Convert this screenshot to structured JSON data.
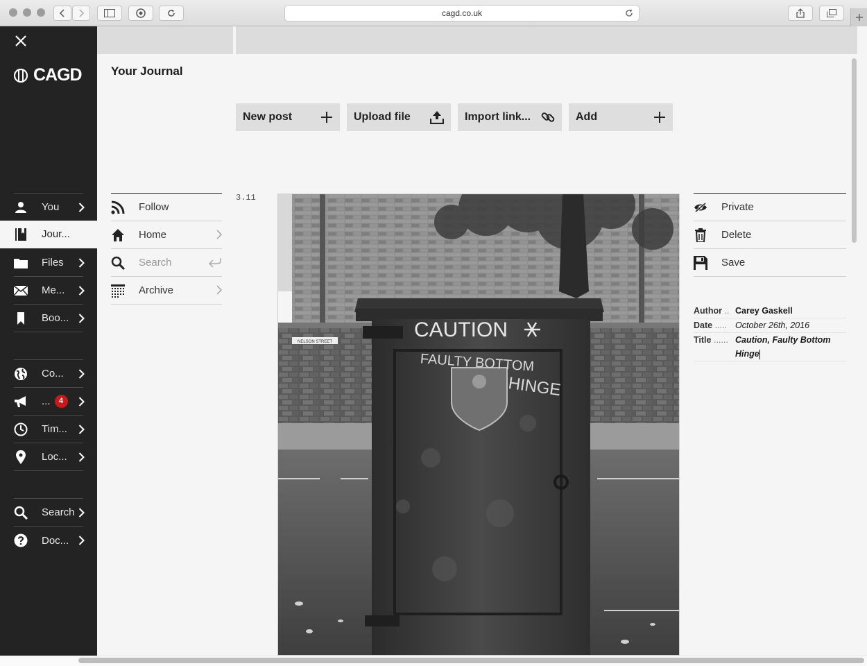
{
  "browser": {
    "url": "cagd.co.uk"
  },
  "sidebar": {
    "brand": "CAGD",
    "primary": [
      {
        "label": "You",
        "icon": "user-icon"
      },
      {
        "label": "Jour...",
        "icon": "journal-icon",
        "active": true
      },
      {
        "label": "Files",
        "icon": "folder-icon"
      },
      {
        "label": "Me...",
        "icon": "mail-icon"
      },
      {
        "label": "Boo...",
        "icon": "bookmark-icon"
      }
    ],
    "secondary": [
      {
        "label": "Co...",
        "icon": "globe-icon"
      },
      {
        "label": "...",
        "icon": "megaphone-icon",
        "badge": "4"
      },
      {
        "label": "Tim...",
        "icon": "clock-icon"
      },
      {
        "label": "Loc...",
        "icon": "pin-icon"
      }
    ],
    "tertiary": [
      {
        "label": "Search",
        "icon": "search-icon"
      },
      {
        "label": "Doc...",
        "icon": "help-icon"
      }
    ]
  },
  "page": {
    "title": "Your Journal"
  },
  "actions": [
    {
      "label": "New post",
      "icon": "plus-icon"
    },
    {
      "label": "Upload file",
      "icon": "upload-icon"
    },
    {
      "label": "Import link...",
      "icon": "link-icon"
    },
    {
      "label": "Add",
      "icon": "plus-icon"
    }
  ],
  "journal_nav": [
    {
      "label": "Follow",
      "icon": "rss-icon"
    },
    {
      "label": "Home",
      "icon": "home-icon"
    },
    {
      "label": "Search",
      "icon": "search-icon",
      "placeholder": true
    },
    {
      "label": "Archive",
      "icon": "calendar-grid-icon"
    }
  ],
  "post": {
    "version": "3.11",
    "photo_text": {
      "sign": "NELSON STREET",
      "graffiti_1": "CAUTION",
      "graffiti_2": "FAULTY BOTTOM",
      "graffiti_3": "HINGE"
    }
  },
  "post_actions": [
    {
      "label": "Private",
      "icon": "eye-slash-icon"
    },
    {
      "label": "Delete",
      "icon": "trash-icon"
    },
    {
      "label": "Save",
      "icon": "floppy-icon"
    }
  ],
  "meta": {
    "author_key": "Author",
    "author_dots": "..",
    "author": "Carey Gaskell",
    "date_key": "Date",
    "date_dots": ".....",
    "date": "October 26th, 2016",
    "title_key": "Title",
    "title_dots": "......",
    "title_line1": "Caution, Faulty Bottom",
    "title_line2": "Hinge"
  }
}
